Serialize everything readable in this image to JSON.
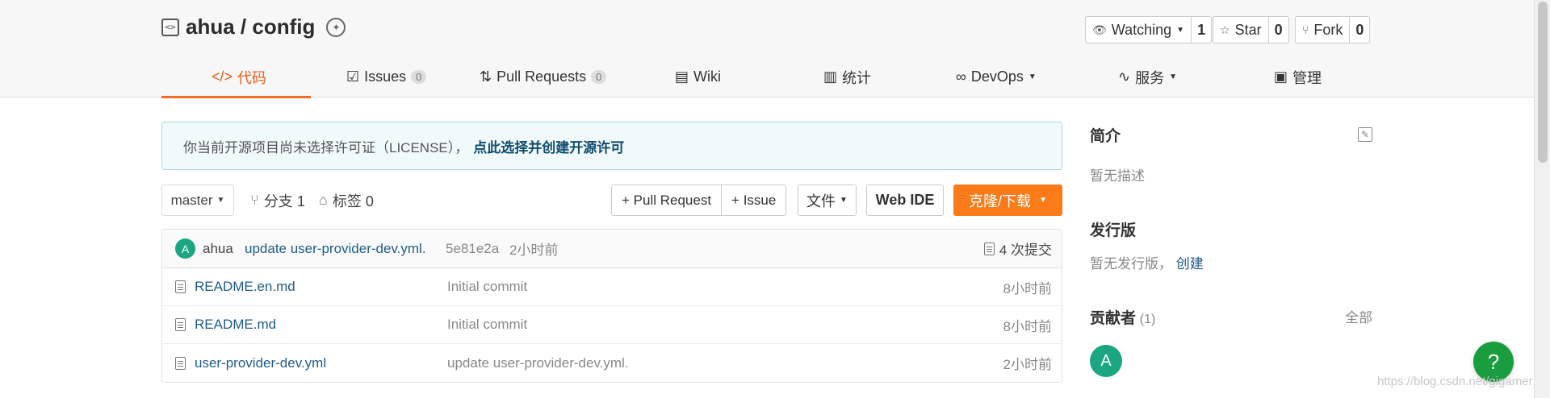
{
  "repo": {
    "title": "ahua / config"
  },
  "actions": {
    "watch": {
      "label": "Watching",
      "count": "1"
    },
    "star": {
      "label": "Star",
      "count": "0"
    },
    "fork": {
      "label": "Fork",
      "count": "0"
    }
  },
  "tabs": [
    {
      "label": "代码",
      "icon": "code-icon"
    },
    {
      "label": "Issues",
      "count": "0",
      "icon": "issues-icon"
    },
    {
      "label": "Pull Requests",
      "count": "0",
      "icon": "pull-request-icon"
    },
    {
      "label": "Wiki",
      "icon": "wiki-icon"
    },
    {
      "label": "统计",
      "icon": "stats-icon"
    },
    {
      "label": "DevOps",
      "icon": "devops-icon"
    },
    {
      "label": "服务",
      "icon": "service-icon"
    },
    {
      "label": "管理",
      "icon": "manage-icon"
    }
  ],
  "notice": {
    "text": "你当前开源项目尚未选择许可证（LICENSE），",
    "link": "点此选择并创建开源许可"
  },
  "toolbar": {
    "branch": "master",
    "branches": "分支 1",
    "tags": "标签 0",
    "new_pr": "+ Pull Request",
    "new_issue": "+ Issue",
    "file": "文件",
    "web_ide": "Web IDE",
    "clone": "克隆/下载"
  },
  "latest_commit": {
    "avatar_letter": "A",
    "author": "ahua",
    "message": "update user-provider-dev.yml.",
    "sha": "5e81e2a",
    "time": "2小时前",
    "count": "4 次提交"
  },
  "files": [
    {
      "name": "README.en.md",
      "message": "Initial commit",
      "time": "8小时前"
    },
    {
      "name": "README.md",
      "message": "Initial commit",
      "time": "8小时前"
    },
    {
      "name": "user-provider-dev.yml",
      "message": "update user-provider-dev.yml.",
      "time": "2小时前"
    }
  ],
  "sidebar": {
    "intro_title": "简介",
    "intro_text": "暂无描述",
    "release_title": "发行版",
    "release_text": "暂无发行版，",
    "release_link": "创建",
    "contrib_title": "贡献者",
    "contrib_count": "(1)",
    "contrib_all": "全部",
    "contrib_avatar": "A"
  },
  "help": "?",
  "watermark": "https://blog.csdn.net/gigamer",
  "colors": {
    "accent": "#f26c21",
    "clone_button": "#fa7b17",
    "avatar": "#1aa681",
    "help": "#1a9d3f",
    "link": "#1f5c87"
  }
}
